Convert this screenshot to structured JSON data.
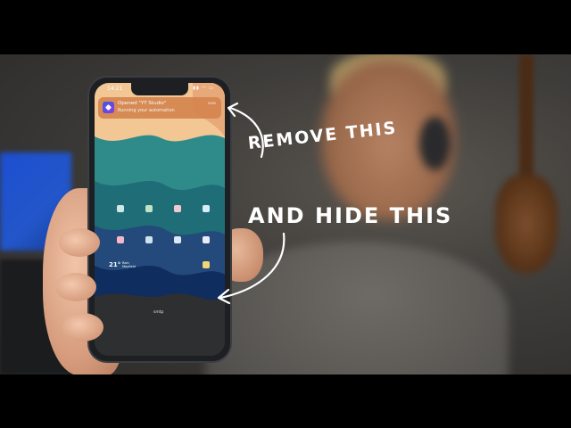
{
  "phone": {
    "status_time": "14:21",
    "status_icons": "▮▮ ◠ ▭",
    "notification": {
      "title": "Opened \"YT Studio\"",
      "body": "Running your automation",
      "time": "now"
    },
    "weather_temp": "21°",
    "weather_desc_line1": "Rain",
    "weather_desc_line2": "Mayfield",
    "widget_label": "smtp"
  },
  "annotations": {
    "remove_text": "REMOVE THIS",
    "hide_text": "AND HIDE THIS"
  },
  "colors": {
    "notification_bg": "#d4844e",
    "wave_peach": "#f3c794",
    "wave_teal": "#2f8b8a",
    "wave_blue": "#234a7a",
    "wave_navy": "#0f2d5e",
    "annotation_text": "#ffffff"
  }
}
